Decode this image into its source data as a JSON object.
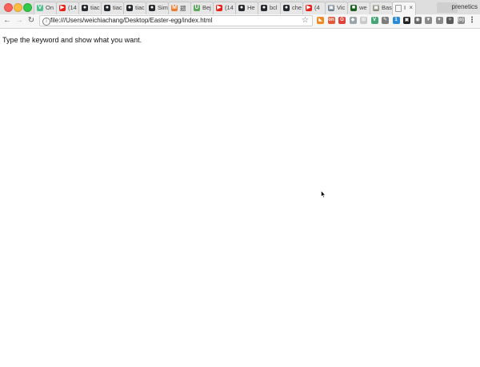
{
  "tabstrip": {
    "tabs": [
      {
        "label": "On",
        "favicon": "vue-icon",
        "color": "#4fc08d",
        "glyph": "V"
      },
      {
        "label": "(14",
        "favicon": "youtube-icon",
        "color": "#e62117",
        "glyph": "▶"
      },
      {
        "label": "tiac",
        "favicon": "github-icon",
        "color": "#24292e",
        "glyph": "●"
      },
      {
        "label": "tiac",
        "favicon": "github-icon",
        "color": "#24292e",
        "glyph": "●"
      },
      {
        "label": "tiac",
        "favicon": "github-icon",
        "color": "#24292e",
        "glyph": "●"
      },
      {
        "label": "Sim",
        "favicon": "github-icon",
        "color": "#24292e",
        "glyph": "●"
      },
      {
        "label": "题",
        "favicon": "site-icon",
        "color": "#e97d2f",
        "glyph": "M"
      },
      {
        "label": "Bej",
        "favicon": "udemy-icon",
        "color": "#5ca85c",
        "glyph": "U"
      },
      {
        "label": "(14",
        "favicon": "youtube-icon",
        "color": "#e62117",
        "glyph": "▶"
      },
      {
        "label": "He",
        "favicon": "github-icon",
        "color": "#24292e",
        "glyph": "●"
      },
      {
        "label": "bcl",
        "favicon": "github-icon",
        "color": "#24292e",
        "glyph": "●"
      },
      {
        "label": "che",
        "favicon": "github-icon",
        "color": "#24292e",
        "glyph": "●"
      },
      {
        "label": "(4",
        "favicon": "youtube-icon",
        "color": "#e62117",
        "glyph": "▶"
      },
      {
        "label": "Vic",
        "favicon": "image-icon",
        "color": "#6b7b8c",
        "glyph": "▣"
      },
      {
        "label": "we",
        "favicon": "site-icon",
        "color": "#1b5e20",
        "glyph": "■"
      },
      {
        "label": "Bas",
        "favicon": "image-icon",
        "color": "#8a8a7a",
        "glyph": "▣"
      }
    ],
    "active_tab": {
      "label": "I",
      "favicon": "page-icon",
      "close": "×"
    },
    "profile_name": "prenetics"
  },
  "toolbar": {
    "back": "←",
    "forward": "→",
    "reload": "↻",
    "info_glyph": "i",
    "url": "file:///Users/weichiachang/Desktop/Easter-egg/index.html",
    "star": "☆",
    "extensions": [
      {
        "name": "extension-1-icon",
        "color": "#f08a24",
        "glyph": "◣"
      },
      {
        "name": "extension-2-icon",
        "color": "#e05a3a",
        "glyph": "on"
      },
      {
        "name": "extension-3-icon",
        "color": "#e0403a",
        "glyph": "O"
      },
      {
        "name": "extension-4-icon",
        "color": "#9aa5a9",
        "glyph": "◆"
      },
      {
        "name": "extension-5-icon",
        "color": "#c9c9c9",
        "glyph": "⊞"
      },
      {
        "name": "extension-6-icon",
        "color": "#45a778",
        "glyph": "V"
      },
      {
        "name": "extension-7-icon",
        "color": "#7d7d7d",
        "glyph": "✎"
      },
      {
        "name": "extension-8-icon",
        "color": "#2b8bd6",
        "glyph": "1"
      },
      {
        "name": "extension-9-icon",
        "color": "#222222",
        "glyph": "▣"
      },
      {
        "name": "extension-10-icon",
        "color": "#6a6a6a",
        "glyph": "◉"
      },
      {
        "name": "extension-11-icon",
        "color": "#8a8a8a",
        "glyph": "▼"
      },
      {
        "name": "extension-12-icon",
        "color": "#8a8a8a",
        "glyph": "✦"
      },
      {
        "name": "extension-13-icon",
        "color": "#5a5a5a",
        "glyph": "✧"
      },
      {
        "name": "extension-14-icon",
        "color": "#8a8a8a",
        "glyph": "(o)"
      },
      {
        "name": "menu-icon",
        "color": "#5c5c5c",
        "glyph": "⋮"
      }
    ]
  },
  "page": {
    "text": "Type the keyword and show what you want."
  }
}
